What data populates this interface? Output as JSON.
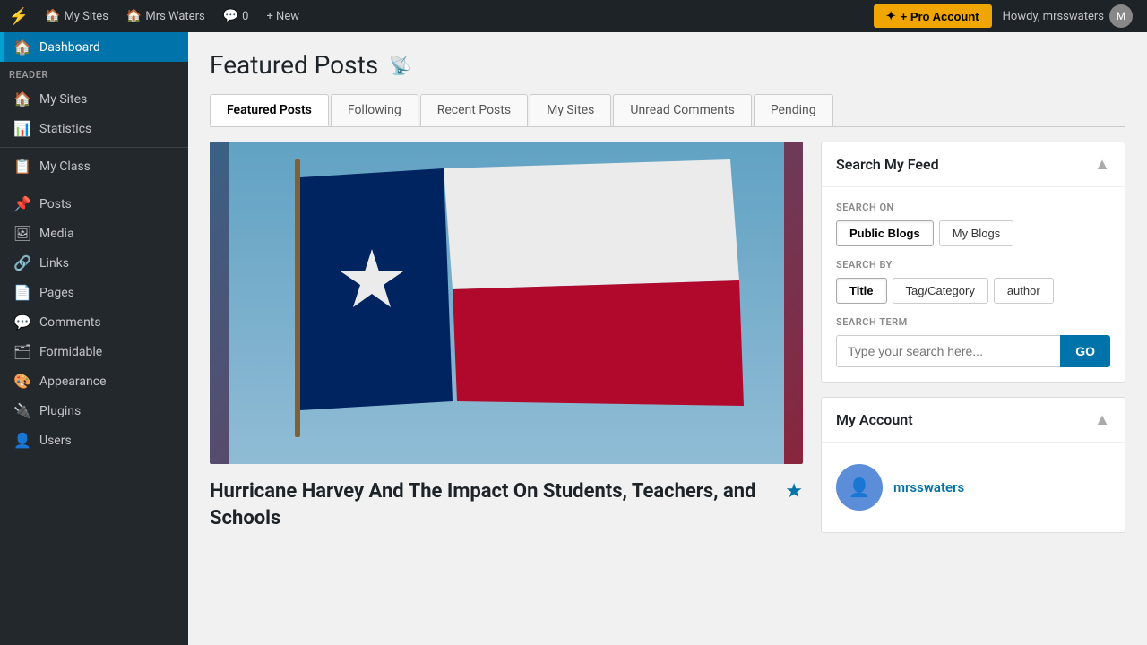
{
  "adminBar": {
    "logoSymbol": "⚡",
    "mySitesLabel": "My Sites",
    "userLabel": "Mrs Waters",
    "commentsLabel": "0",
    "newLabel": "+ New",
    "proAccountLabel": "+ Pro Account",
    "howdyLabel": "Howdy, mrsswaters"
  },
  "sidebar": {
    "dashboardLabel": "Dashboard",
    "reader": {
      "header": "Reader",
      "items": [
        {
          "label": "My Sites",
          "icon": "🏠"
        },
        {
          "label": "Statistics",
          "icon": "📊"
        }
      ]
    },
    "myClassLabel": "My Class",
    "items": [
      {
        "label": "Posts",
        "icon": "📌"
      },
      {
        "label": "Media",
        "icon": "🖼"
      },
      {
        "label": "Links",
        "icon": "🔗"
      },
      {
        "label": "Pages",
        "icon": "📄"
      },
      {
        "label": "Comments",
        "icon": "💬"
      },
      {
        "label": "Formidable",
        "icon": "🗂"
      },
      {
        "label": "Appearance",
        "icon": "🎨"
      },
      {
        "label": "Plugins",
        "icon": "🔌"
      },
      {
        "label": "Users",
        "icon": "👤"
      }
    ]
  },
  "main": {
    "pageTitle": "Featured Posts",
    "rssSymbol": "📡",
    "tabs": [
      {
        "label": "Featured Posts",
        "active": true
      },
      {
        "label": "Following",
        "active": false
      },
      {
        "label": "Recent Posts",
        "active": false
      },
      {
        "label": "My Sites",
        "active": false
      },
      {
        "label": "Unread Comments",
        "active": false
      },
      {
        "label": "Pending",
        "active": false
      }
    ],
    "featuredPost": {
      "title": "Hurricane Harvey And The Impact On Students, Teachers, and Schools",
      "starSymbol": "★"
    }
  },
  "searchWidget": {
    "title": "Search My Feed",
    "collapseSymbol": "▲",
    "searchOnLabel": "SEARCH ON",
    "searchOnOptions": [
      {
        "label": "Public Blogs",
        "active": true
      },
      {
        "label": "My Blogs",
        "active": false
      }
    ],
    "searchByLabel": "SEARCH BY",
    "searchByOptions": [
      {
        "label": "Title",
        "active": true
      },
      {
        "label": "Tag/Category",
        "active": false
      },
      {
        "label": "author",
        "active": false
      }
    ],
    "searchTermLabel": "SEARCH TERM",
    "searchPlaceholder": "Type your search here...",
    "goLabel": "GO"
  },
  "accountWidget": {
    "title": "My Account",
    "collapseSymbol": "▲",
    "username": "mrsswaters",
    "avatarSymbol": "👤"
  }
}
